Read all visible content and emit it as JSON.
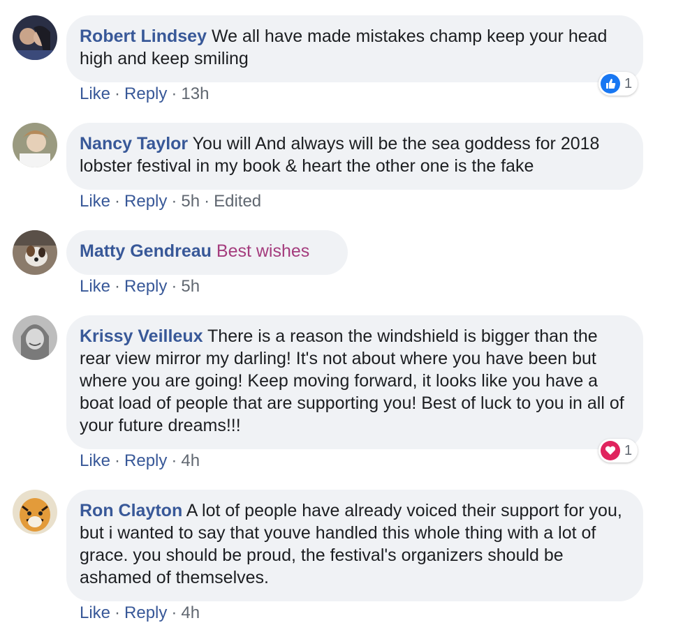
{
  "comments": [
    {
      "author": "Robert Lindsey",
      "text": "We all have made mistakes champ keep your head high and keep smiling",
      "like": "Like",
      "reply": "Reply",
      "time": "13h",
      "edited": "",
      "reaction": {
        "type": "like",
        "count": "1",
        "color": "#1877f2"
      }
    },
    {
      "author": "Nancy Taylor",
      "text": "You will And always will be the sea goddess for 2018 lobster festival in my book & heart the other one is the fake",
      "like": "Like",
      "reply": "Reply",
      "time": "5h",
      "edited": "Edited"
    },
    {
      "author": "Matty Gendreau",
      "text": "Best wishes",
      "text_color": "#a43c7d",
      "like": "Like",
      "reply": "Reply",
      "time": "5h",
      "edited": ""
    },
    {
      "author": "Krissy Veilleux",
      "text": "There is a reason the windshield is bigger than the rear view mirror my darling! It's not about where you have been but where you are going! Keep moving forward, it looks like you have a boat load of people that are supporting you! Best of luck to you in all of your future dreams!!!",
      "like": "Like",
      "reply": "Reply",
      "time": "4h",
      "edited": "",
      "reaction": {
        "type": "love",
        "count": "1",
        "color": "#e0245e"
      }
    },
    {
      "author": "Ron Clayton",
      "text": "A lot of people have already voiced their support for you, but i wanted to say that youve handled this whole thing with a lot of grace. you should be proud, the festival's organizers should be ashamed of themselves.",
      "like": "Like",
      "reply": "Reply",
      "time": "4h",
      "edited": ""
    }
  ],
  "separator": "·"
}
